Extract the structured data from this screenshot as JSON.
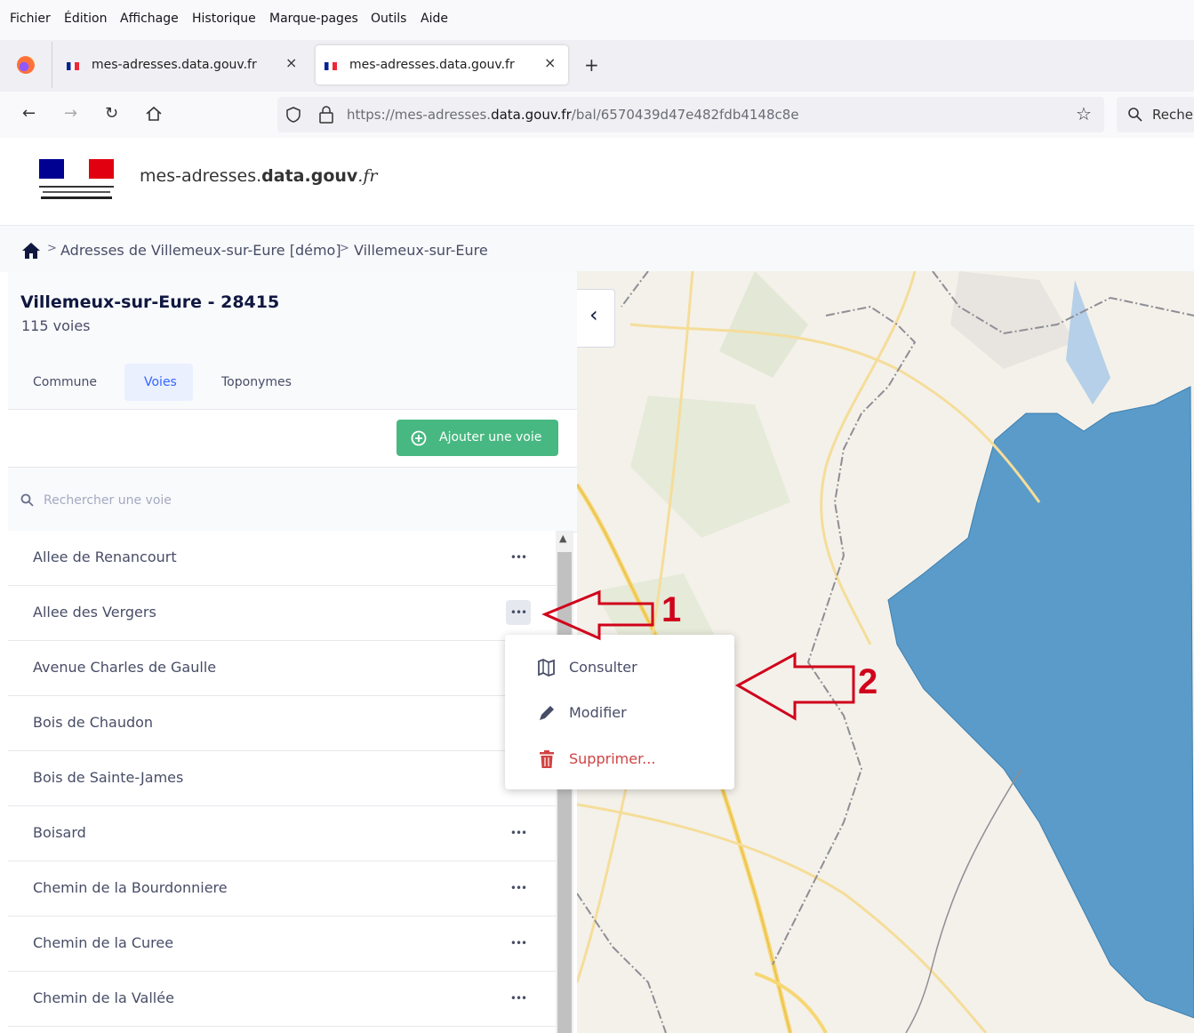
{
  "browser": {
    "menu": [
      "Fichier",
      "Édition",
      "Affichage",
      "Historique",
      "Marque-pages",
      "Outils",
      "Aide"
    ],
    "tabs": [
      {
        "title": "mes-adresses.data.gouv.fr",
        "close": "×"
      },
      {
        "title": "mes-adresses.data.gouv.fr",
        "close": "×"
      }
    ],
    "new_tab": "+",
    "url": {
      "prefix": "https://mes-adresses.",
      "domain": "data.gouv.fr",
      "path": "/bal/6570439d47e482fdb4148c8e"
    },
    "search_placeholder": "Reche"
  },
  "site": {
    "brand_prefix": "mes-adresses.",
    "brand_bold": "data.gouv",
    "brand_suffix": ".fr"
  },
  "breadcrumb": {
    "sep1": ">",
    "item1": "Adresses de Villemeux-sur-Eure [démo]",
    "sep2": ">",
    "item2": "Villemeux-sur-Eure"
  },
  "commune": {
    "title": "Villemeux-sur-Eure - 28415",
    "subtitle": "115 voies"
  },
  "tabs": {
    "commune": "Commune",
    "voies": "Voies",
    "toponymes": "Toponymes",
    "active": "Voies"
  },
  "add_button": {
    "label": "Ajouter une voie",
    "color": "#47b881"
  },
  "search": {
    "placeholder": "Rechercher une voie"
  },
  "voies": [
    "Allee de Renancourt",
    "Allee des Vergers",
    "Avenue Charles de Gaulle",
    "Bois de Chaudon",
    "Bois de Sainte-James",
    "Boisard",
    "Chemin de la Bourdonniere",
    "Chemin de la Curee",
    "Chemin de la Vallée"
  ],
  "dots_label": "•••",
  "context_menu": {
    "consulter": "Consulter",
    "modifier": "Modifier",
    "supprimer": "Supprimer..."
  },
  "annotations": {
    "arrow1": "1",
    "arrow2": "2",
    "color": "#d0021b"
  },
  "map": {
    "collapse_icon": "‹",
    "commune_fill": "#5a9bc9"
  }
}
